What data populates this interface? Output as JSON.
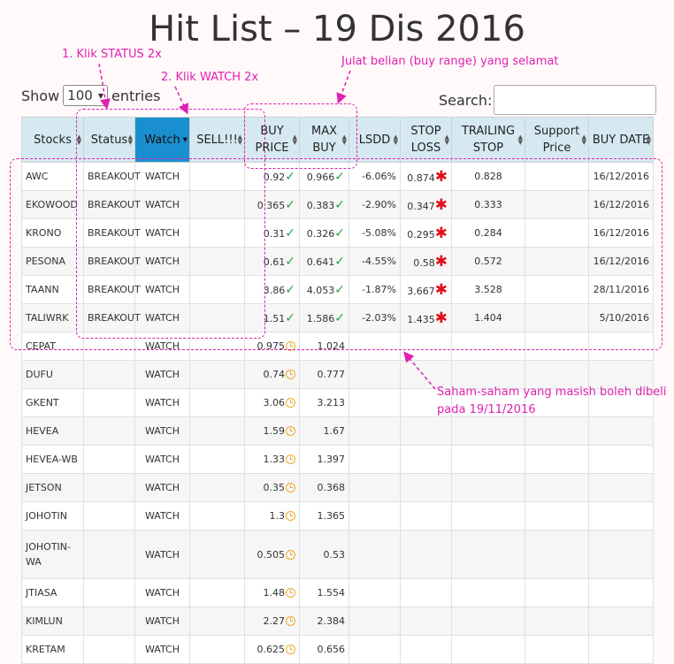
{
  "page": {
    "title": "Hit List – 19 Dis 2016"
  },
  "controls": {
    "show_label": "Show",
    "length_value": "100",
    "entries_label": "entries",
    "search_label": "Search:"
  },
  "columns": [
    "Stocks",
    "Status",
    "Watch",
    "SELL!!!",
    "BUY PRICE",
    "MAX BUY",
    "LSDD",
    "STOP LOSS",
    "TRAILING STOP",
    "Support Price",
    "BUY DATE"
  ],
  "sorted_column": "Watch",
  "rows": [
    {
      "stock": "AWC",
      "status": "BREAKOUT",
      "watch": "WATCH",
      "sell": "",
      "buy": "0.92",
      "buy_icon": "check",
      "max": "0.966",
      "max_icon": "check",
      "lsdd": "-6.06%",
      "stop": "0.874",
      "stop_icon": "star",
      "trail": "0.828",
      "support": "",
      "date": "16/12/2016"
    },
    {
      "stock": "EKOWOOD",
      "status": "BREAKOUT",
      "watch": "WATCH",
      "sell": "",
      "buy": "0.365",
      "buy_icon": "check",
      "max": "0.383",
      "max_icon": "check",
      "lsdd": "-2.90%",
      "stop": "0.347",
      "stop_icon": "star",
      "trail": "0.333",
      "support": "",
      "date": "16/12/2016"
    },
    {
      "stock": "KRONO",
      "status": "BREAKOUT",
      "watch": "WATCH",
      "sell": "",
      "buy": "0.31",
      "buy_icon": "check",
      "max": "0.326",
      "max_icon": "check",
      "lsdd": "-5.08%",
      "stop": "0.295",
      "stop_icon": "star",
      "trail": "0.284",
      "support": "",
      "date": "16/12/2016"
    },
    {
      "stock": "PESONA",
      "status": "BREAKOUT",
      "watch": "WATCH",
      "sell": "",
      "buy": "0.61",
      "buy_icon": "check",
      "max": "0.641",
      "max_icon": "check",
      "lsdd": "-4.55%",
      "stop": "0.58",
      "stop_icon": "star",
      "trail": "0.572",
      "support": "",
      "date": "16/12/2016"
    },
    {
      "stock": "TAANN",
      "status": "BREAKOUT",
      "watch": "WATCH",
      "sell": "",
      "buy": "3.86",
      "buy_icon": "check",
      "max": "4.053",
      "max_icon": "check",
      "lsdd": "-1.87%",
      "stop": "3.667",
      "stop_icon": "star",
      "trail": "3.528",
      "support": "",
      "date": "28/11/2016"
    },
    {
      "stock": "TALIWRK",
      "status": "BREAKOUT",
      "watch": "WATCH",
      "sell": "",
      "buy": "1.51",
      "buy_icon": "check",
      "max": "1.586",
      "max_icon": "check",
      "lsdd": "-2.03%",
      "stop": "1.435",
      "stop_icon": "star",
      "trail": "1.404",
      "support": "",
      "date": "5/10/2016"
    },
    {
      "stock": "CEPAT",
      "status": "",
      "watch": "WATCH",
      "sell": "",
      "buy": "0.975",
      "buy_icon": "clock",
      "max": "1.024",
      "max_icon": "",
      "lsdd": "",
      "stop": "",
      "stop_icon": "",
      "trail": "",
      "support": "",
      "date": ""
    },
    {
      "stock": "DUFU",
      "status": "",
      "watch": "WATCH",
      "sell": "",
      "buy": "0.74",
      "buy_icon": "clock",
      "max": "0.777",
      "max_icon": "",
      "lsdd": "",
      "stop": "",
      "stop_icon": "",
      "trail": "",
      "support": "",
      "date": ""
    },
    {
      "stock": "GKENT",
      "status": "",
      "watch": "WATCH",
      "sell": "",
      "buy": "3.06",
      "buy_icon": "clock",
      "max": "3.213",
      "max_icon": "",
      "lsdd": "",
      "stop": "",
      "stop_icon": "",
      "trail": "",
      "support": "",
      "date": ""
    },
    {
      "stock": "HEVEA",
      "status": "",
      "watch": "WATCH",
      "sell": "",
      "buy": "1.59",
      "buy_icon": "clock",
      "max": "1.67",
      "max_icon": "",
      "lsdd": "",
      "stop": "",
      "stop_icon": "",
      "trail": "",
      "support": "",
      "date": ""
    },
    {
      "stock": "HEVEA-WB",
      "status": "",
      "watch": "WATCH",
      "sell": "",
      "buy": "1.33",
      "buy_icon": "clock",
      "max": "1.397",
      "max_icon": "",
      "lsdd": "",
      "stop": "",
      "stop_icon": "",
      "trail": "",
      "support": "",
      "date": ""
    },
    {
      "stock": "JETSON",
      "status": "",
      "watch": "WATCH",
      "sell": "",
      "buy": "0.35",
      "buy_icon": "clock",
      "max": "0.368",
      "max_icon": "",
      "lsdd": "",
      "stop": "",
      "stop_icon": "",
      "trail": "",
      "support": "",
      "date": ""
    },
    {
      "stock": "JOHOTIN",
      "status": "",
      "watch": "WATCH",
      "sell": "",
      "buy": "1.3",
      "buy_icon": "clock",
      "max": "1.365",
      "max_icon": "",
      "lsdd": "",
      "stop": "",
      "stop_icon": "",
      "trail": "",
      "support": "",
      "date": ""
    },
    {
      "stock": "JOHOTIN-WA",
      "status": "",
      "watch": "WATCH",
      "sell": "",
      "buy": "0.505",
      "buy_icon": "clock",
      "max": "0.53",
      "max_icon": "",
      "lsdd": "",
      "stop": "",
      "stop_icon": "",
      "trail": "",
      "support": "",
      "date": ""
    },
    {
      "stock": "JTIASA",
      "status": "",
      "watch": "WATCH",
      "sell": "",
      "buy": "1.48",
      "buy_icon": "clock",
      "max": "1.554",
      "max_icon": "",
      "lsdd": "",
      "stop": "",
      "stop_icon": "",
      "trail": "",
      "support": "",
      "date": ""
    },
    {
      "stock": "KIMLUN",
      "status": "",
      "watch": "WATCH",
      "sell": "",
      "buy": "2.27",
      "buy_icon": "clock",
      "max": "2.384",
      "max_icon": "",
      "lsdd": "",
      "stop": "",
      "stop_icon": "",
      "trail": "",
      "support": "",
      "date": ""
    },
    {
      "stock": "KRETAM",
      "status": "",
      "watch": "WATCH",
      "sell": "",
      "buy": "0.625",
      "buy_icon": "clock",
      "max": "0.656",
      "max_icon": "",
      "lsdd": "",
      "stop": "",
      "stop_icon": "",
      "trail": "",
      "support": "",
      "date": ""
    }
  ],
  "annotations": {
    "step1": "1. Klik STATUS 2x",
    "step2": "2. Klik WATCH 2x",
    "buy_range": "Julat belian (buy range) yang selamat",
    "still_buyable_line1": "Saham-saham yang masish boleh dibeli",
    "still_buyable_line2": "pada 19/11/2016"
  },
  "colors": {
    "annotation": "#e020b0",
    "header": "#d6e9f2",
    "sorted_header": "#1a8fd0",
    "check": "#2aa14a",
    "star": "#e0101c",
    "clock": "#f0a92c"
  }
}
